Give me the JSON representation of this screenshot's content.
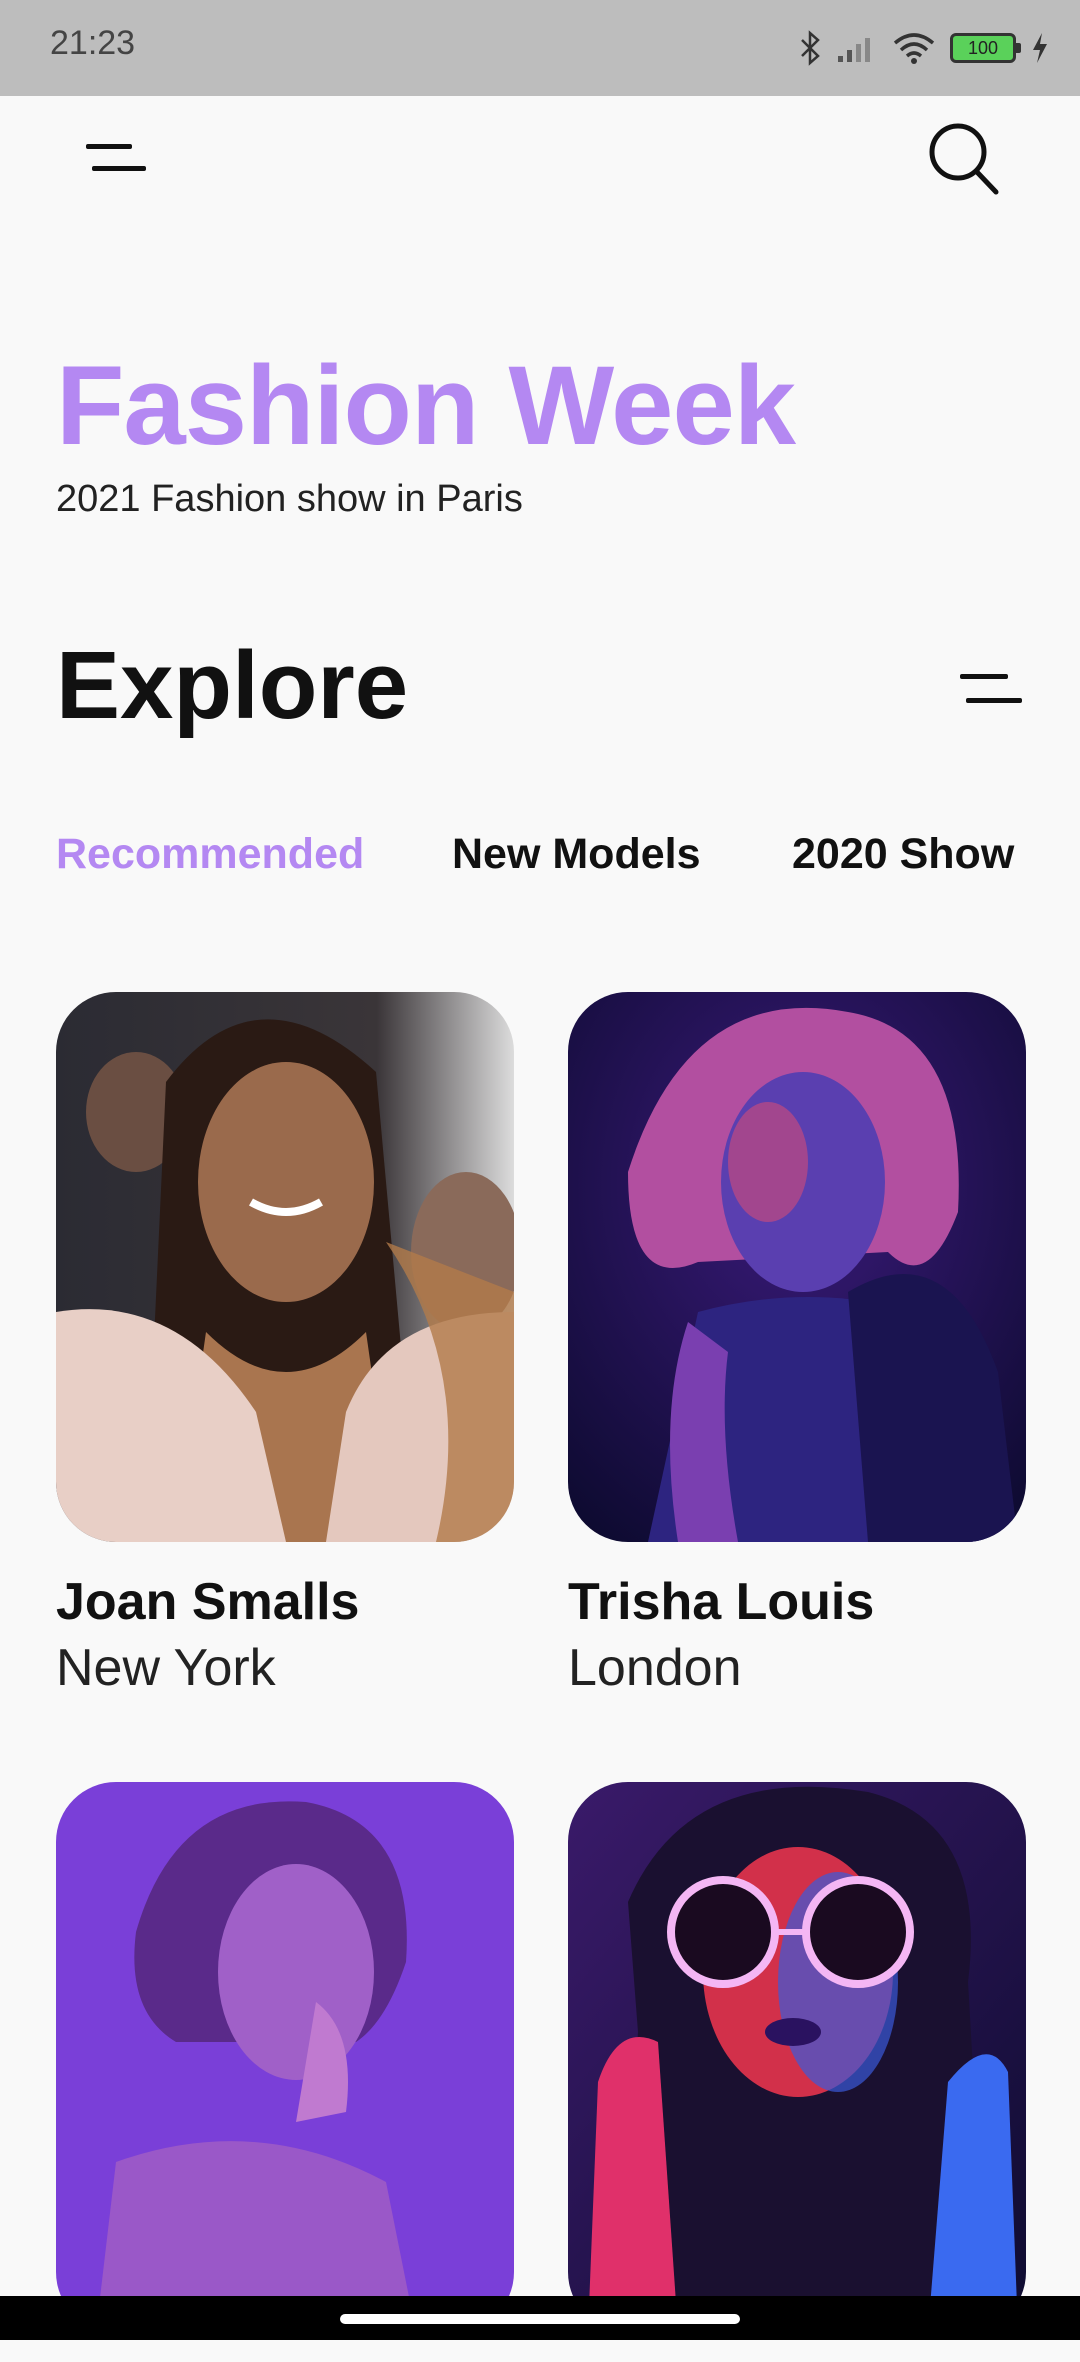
{
  "status_bar": {
    "time": "21:23",
    "battery": "100",
    "icons": [
      "bluetooth-icon",
      "signal-icon",
      "wifi-icon",
      "battery-icon",
      "charging-icon"
    ]
  },
  "header": {
    "menu_icon": "menu-icon",
    "search_icon": "search-icon"
  },
  "hero": {
    "title": "Fashion Week",
    "subtitle": "2021 Fashion show in Paris"
  },
  "explore": {
    "title": "Explore",
    "filter_icon": "filter-icon",
    "tabs": [
      {
        "label": "Recommended",
        "active": true
      },
      {
        "label": "New Models",
        "active": false
      },
      {
        "label": "2020 Show",
        "active": false
      }
    ]
  },
  "models": [
    {
      "name": "Joan Smalls",
      "city": "New York"
    },
    {
      "name": "Trisha Louis",
      "city": "London"
    },
    {
      "name": "",
      "city": ""
    },
    {
      "name": "",
      "city": ""
    }
  ],
  "colors": {
    "accent": "#b488f2",
    "text": "#111111",
    "background": "#f9f9f9"
  }
}
